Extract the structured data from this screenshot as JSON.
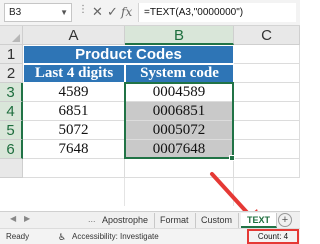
{
  "formula_bar": {
    "name_box": "B3",
    "formula": "=TEXT(A3,\"0000000\")",
    "cancel_icon": "close-icon",
    "enter_icon": "check-icon",
    "fx_label": "fx"
  },
  "columns": [
    "A",
    "B",
    "C"
  ],
  "rows": [
    "1",
    "2",
    "3",
    "4",
    "5",
    "6"
  ],
  "table": {
    "title": "Product Codes",
    "headers": [
      "Last 4 digits",
      "System code"
    ],
    "data": [
      [
        "4589",
        "0004589"
      ],
      [
        "6851",
        "0006851"
      ],
      [
        "5072",
        "0005072"
      ],
      [
        "7648",
        "0007648"
      ]
    ]
  },
  "sheet_tabs": {
    "items": [
      "Apostrophe",
      "Format",
      "Custom",
      "TEXT"
    ],
    "active": "TEXT",
    "ellipsis": "...",
    "add_label": "+"
  },
  "status_bar": {
    "ready": "Ready",
    "accessibility": "Accessibility: Investigate",
    "count": "Count: 4"
  },
  "colors": {
    "header_fill": "#2e75b6",
    "selection": "#217346",
    "highlight_fill": "#c9c9c9",
    "annotation": "#e53935"
  }
}
